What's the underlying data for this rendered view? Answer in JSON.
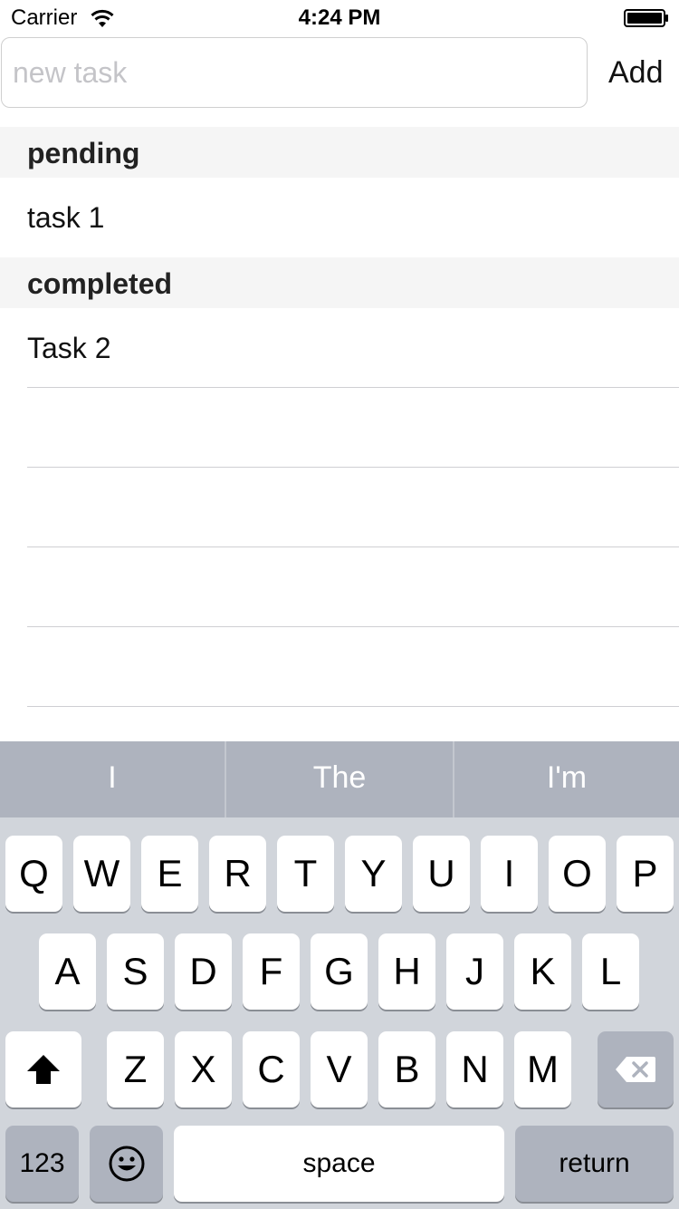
{
  "status_bar": {
    "carrier": "Carrier",
    "time": "4:24 PM",
    "wifi_icon": "wifi-icon",
    "battery_icon": "battery-full-icon"
  },
  "task_form": {
    "input_value": "",
    "input_placeholder": "new task",
    "add_label": "Add"
  },
  "sections": {
    "pending": {
      "title": "pending",
      "tasks": [
        "task 1"
      ]
    },
    "completed": {
      "title": "completed",
      "tasks": [
        "Task 2"
      ]
    }
  },
  "keyboard": {
    "suggestions": [
      "I",
      "The",
      "I'm"
    ],
    "row1": [
      "Q",
      "W",
      "E",
      "R",
      "T",
      "Y",
      "U",
      "I",
      "O",
      "P"
    ],
    "row2": [
      "A",
      "S",
      "D",
      "F",
      "G",
      "H",
      "J",
      "K",
      "L"
    ],
    "row3": [
      "Z",
      "X",
      "C",
      "V",
      "B",
      "N",
      "M"
    ],
    "shift_icon": "shift-arrow-icon",
    "delete_icon": "backspace-icon",
    "numbers_label": "123",
    "emoji_icon": "emoji-smiley-icon",
    "space_label": "space",
    "return_label": "return"
  }
}
